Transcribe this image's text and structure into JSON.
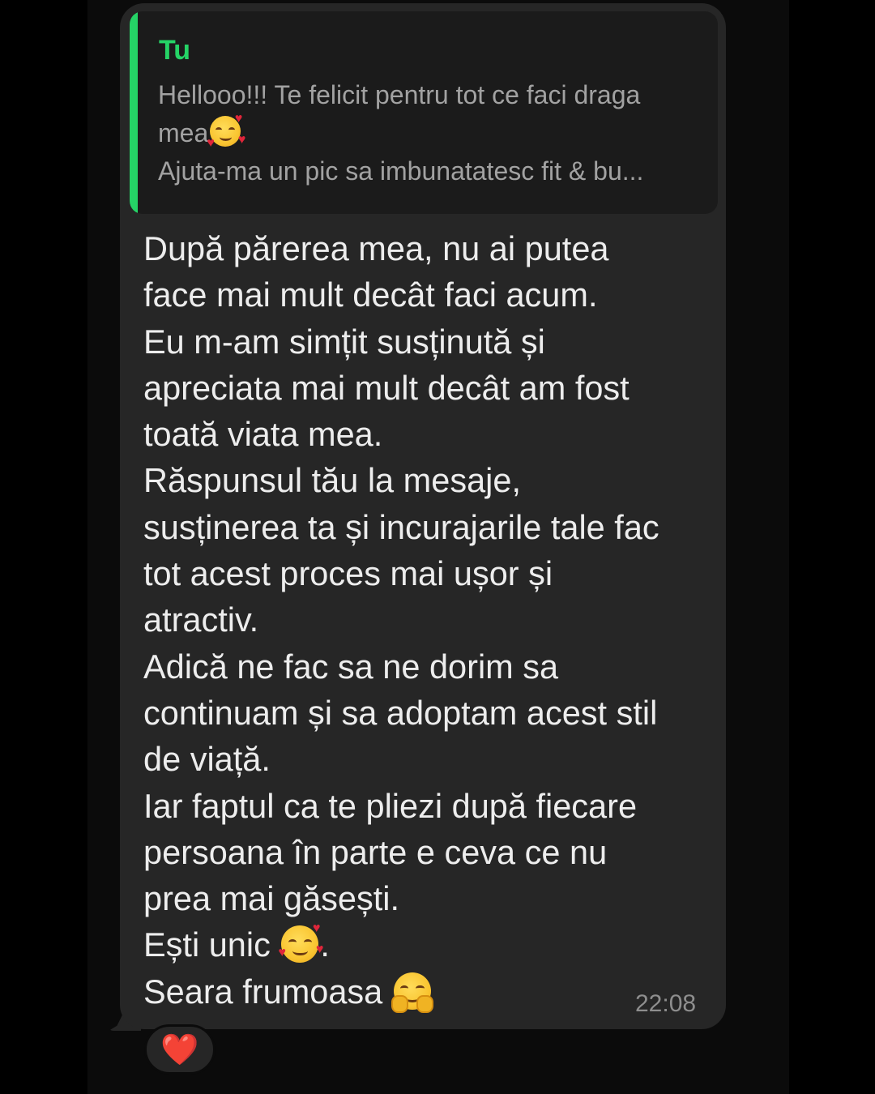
{
  "reply_quote": {
    "author": "Tu",
    "lines": [
      "Hellooo!!! Te felicit pentru tot ce faci draga",
      "mea",
      "Ajuta-ma un pic sa imbunatatesc fit & bu..."
    ],
    "accent_color": "#25d366"
  },
  "message": {
    "lines": [
      "După părerea mea, nu ai putea",
      "face mai mult decât faci acum.",
      "Eu m-am simțit susținută și",
      "apreciata mai mult decât am fost",
      "toată viata mea.",
      "Răspunsul tău la mesaje,",
      "susținerea ta și incurajarile tale fac",
      "tot acest proces mai ușor și",
      "atractiv.",
      "Adică ne fac sa ne dorim sa",
      "continuam și sa adoptam acest stil",
      "de viață.",
      "Iar faptul ca te pliezi după fiecare",
      "persoana în parte e ceva ce nu",
      "prea mai găsești.",
      "Ești unic",
      ".",
      "Seara frumoasa"
    ],
    "emojis": {
      "quote_end": "smiling-face-with-hearts-icon",
      "unic_line": "smiling-face-with-hearts-icon",
      "seara_line": "hugging-face-icon"
    },
    "time": "22:08"
  },
  "reaction": {
    "emoji": "❤️",
    "icon": "red-heart-icon"
  }
}
